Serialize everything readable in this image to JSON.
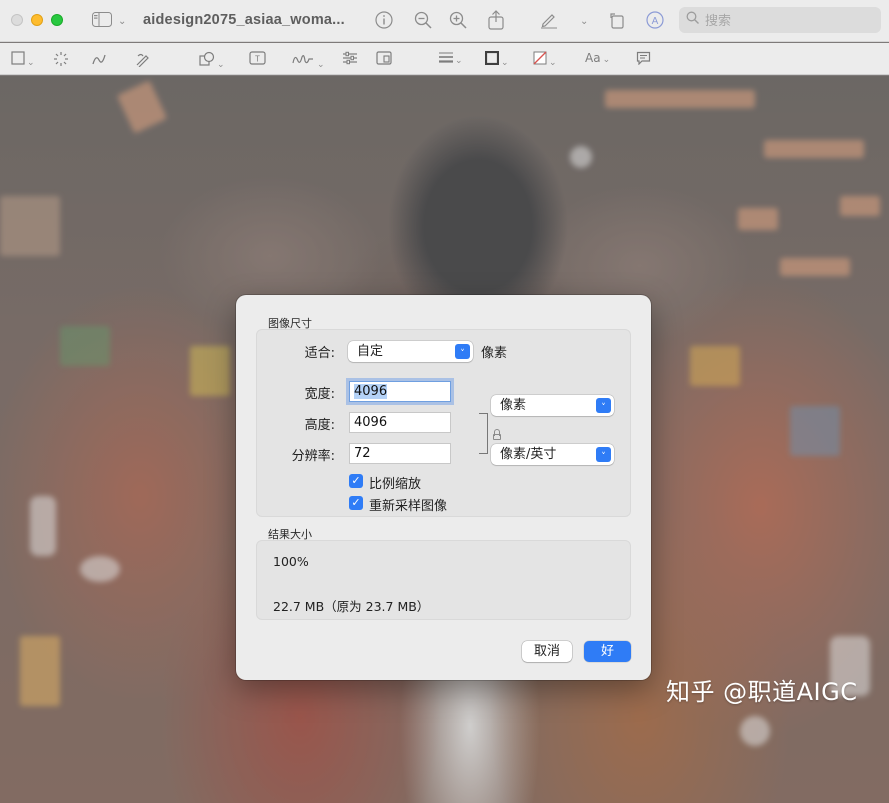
{
  "window": {
    "title": "aidesign2075_asiaa_woma...",
    "search_placeholder": "搜索"
  },
  "canvas": {
    "watermark": "知乎 @职道AIGC"
  },
  "dialog": {
    "image_size_section": "图像尺寸",
    "fit_label": "适合:",
    "fit_value": "自定",
    "fit_unit": "像素",
    "width_label": "宽度:",
    "width_value": "4096",
    "height_label": "高度:",
    "height_value": "4096",
    "size_unit": "像素",
    "resolution_label": "分辨率:",
    "resolution_value": "72",
    "resolution_unit": "像素/英寸",
    "scale_proportionally": "比例缩放",
    "scale_proportionally_checked": true,
    "resample_image": "重新采样图像",
    "resample_image_checked": true,
    "result_section": "结果大小",
    "result_percent": "100%",
    "result_size": "22.7 MB（原为 23.7 MB）",
    "cancel_button": "取消",
    "ok_button": "好"
  },
  "colors": {
    "accent": "#2f7cf6",
    "dialog_bg": "#ececec"
  }
}
